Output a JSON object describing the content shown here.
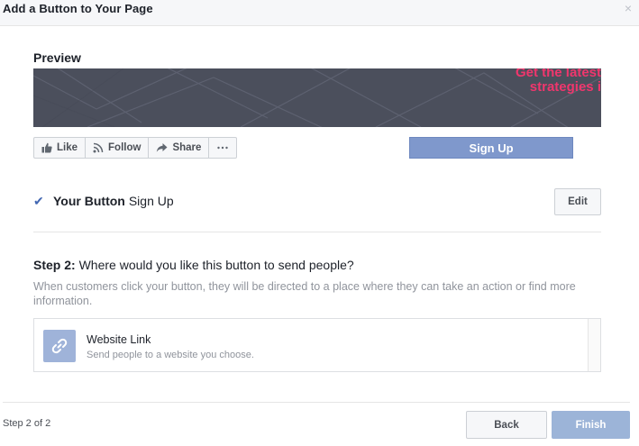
{
  "dialog": {
    "title": "Add a Button to Your Page",
    "close_glyph": "×"
  },
  "preview": {
    "heading": "Preview",
    "banner_line1": "Get the latest",
    "banner_line2": "strategies i",
    "banner_text_color": "#f0366d",
    "banner_bg": "#4b4f5c",
    "actions": [
      {
        "label": "Like",
        "icon": "thumbs-up-icon"
      },
      {
        "label": "Follow",
        "icon": "rss-icon"
      },
      {
        "label": "Share",
        "icon": "share-arrow-icon"
      },
      {
        "label": "",
        "icon": "more-dots-icon"
      }
    ],
    "cta_label": "Sign Up"
  },
  "your_button": {
    "label_strong": "Your Button",
    "value": "Sign Up",
    "edit_label": "Edit",
    "check_glyph": "✔"
  },
  "step2": {
    "label": "Step 2:",
    "question": "Where would you like this button to send people?",
    "description": "When customers click your button, they will be directed to a place where they can take an action or find more information.",
    "option": {
      "title": "Website Link",
      "subtitle": "Send people to a website you choose.",
      "icon": "link-icon"
    }
  },
  "footer": {
    "step_counter": "Step 2 of 2",
    "back_label": "Back",
    "finish_label": "Finish"
  },
  "colors": {
    "brand_blue": "#4267b2",
    "cta_blue": "#7f98cc",
    "finish_disabled": "#9cb4d8"
  }
}
